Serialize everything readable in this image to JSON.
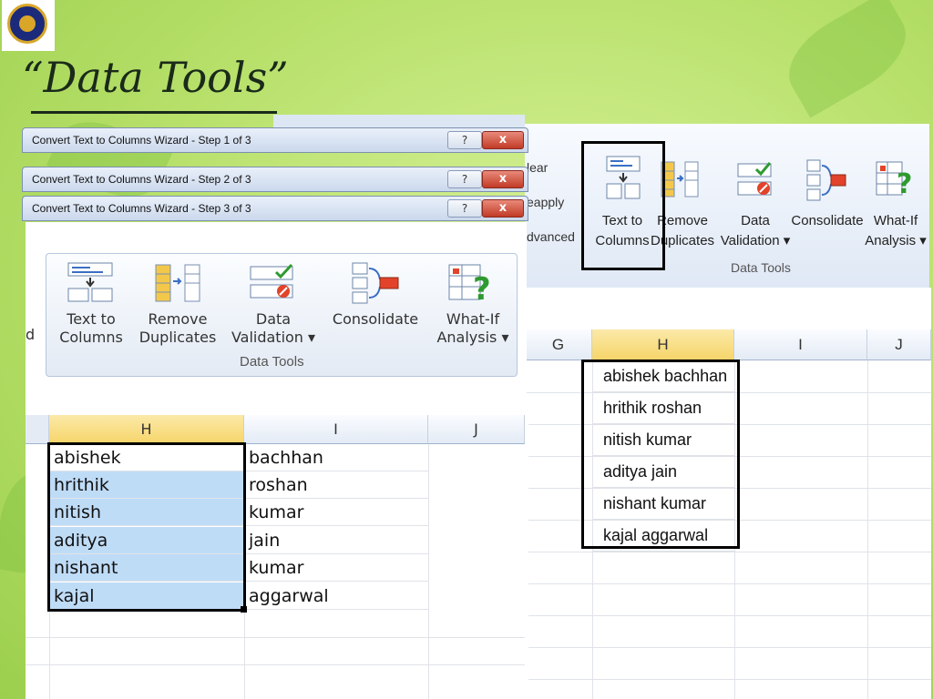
{
  "slide": {
    "title": "“Data Tools”"
  },
  "ribbon_right": {
    "side_buttons": [
      "lear",
      "eapply",
      "dvanced"
    ],
    "buttons": [
      {
        "label1": "Text to",
        "label2": "Columns"
      },
      {
        "label1": "Remove",
        "label2": "Duplicates"
      },
      {
        "label1": "Data",
        "label2": "Validation ▾"
      },
      {
        "label1": "Consolidate",
        "label2": ""
      },
      {
        "label1": "What-If",
        "label2": "Analysis ▾"
      }
    ],
    "group_label": "Data Tools"
  },
  "grid_right": {
    "columns": [
      "G",
      "H",
      "I",
      "J"
    ],
    "rows": [
      "abishek bachhan",
      "hrithik roshan",
      "nitish kumar",
      "aditya jain",
      "nishant kumar",
      "kajal aggarwal"
    ]
  },
  "wizard": {
    "step1_title": "Convert Text to Columns Wizard - Step 1 of 3",
    "step2_title": "Convert Text to Columns Wizard - Step 2 of 3",
    "step3_title": "Convert Text to Columns Wizard - Step 3 of 3",
    "help_label": "?",
    "close_label": "x"
  },
  "ribbon_left": {
    "edge_text": "d",
    "buttons": [
      {
        "label1": "Text to",
        "label2": "Columns"
      },
      {
        "label1": "Remove",
        "label2": "Duplicates"
      },
      {
        "label1": "Data",
        "label2": "Validation ▾"
      },
      {
        "label1": "Consolidate",
        "label2": ""
      },
      {
        "label1": "What-If",
        "label2": "Analysis ▾"
      }
    ],
    "group_label": "Data Tools"
  },
  "grid_left": {
    "columns": [
      "H",
      "I",
      "J"
    ],
    "rows": [
      {
        "h": "abishek",
        "i": "bachhan"
      },
      {
        "h": "hrithik",
        "i": "roshan"
      },
      {
        "h": "nitish",
        "i": "kumar"
      },
      {
        "h": "aditya",
        "i": "jain"
      },
      {
        "h": "nishant",
        "i": "kumar"
      },
      {
        "h": "kajal",
        "i": "aggarwal"
      }
    ]
  }
}
